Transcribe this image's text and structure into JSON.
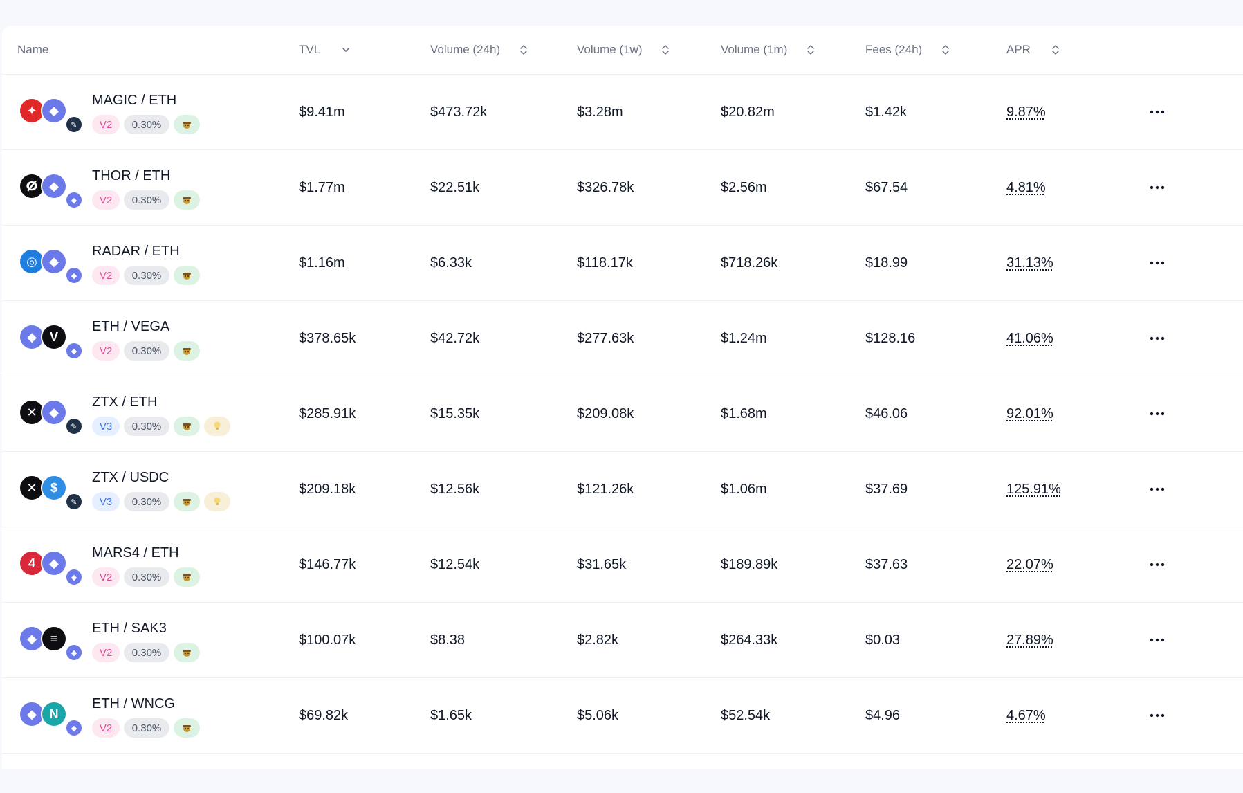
{
  "header": {
    "name": "Name",
    "tvl": "TVL",
    "vol24h": "Volume (24h)",
    "vol1w": "Volume (1w)",
    "vol1m": "Volume (1m)",
    "fees24h": "Fees (24h)",
    "apr": "APR"
  },
  "rows": [
    {
      "pair": "MAGIC / ETH",
      "version": "V2",
      "fee": "0.30%",
      "tvl": "$9.41m",
      "vol24h": "$473.72k",
      "vol1w": "$3.28m",
      "vol1m": "$20.82m",
      "fees24h": "$1.42k",
      "apr": "9.87%",
      "token_a": "magic-token-icon",
      "token_b": "eth-token-icon",
      "chain": "arbitrum-chain-icon",
      "color_a": "#e02828",
      "color_b": "#6b7ae8"
    },
    {
      "pair": "THOR / ETH",
      "version": "V2",
      "fee": "0.30%",
      "tvl": "$1.77m",
      "vol24h": "$22.51k",
      "vol1w": "$326.78k",
      "vol1m": "$2.56m",
      "fees24h": "$67.54",
      "apr": "4.81%",
      "token_a": "thor-token-icon",
      "token_b": "eth-token-icon",
      "chain": "ethereum-chain-icon",
      "color_a": "#0d0d12",
      "color_b": "#6b7ae8"
    },
    {
      "pair": "RADAR / ETH",
      "version": "V2",
      "fee": "0.30%",
      "tvl": "$1.16m",
      "vol24h": "$6.33k",
      "vol1w": "$118.17k",
      "vol1m": "$718.26k",
      "fees24h": "$18.99",
      "apr": "31.13%",
      "token_a": "radar-token-icon",
      "token_b": "eth-token-icon",
      "chain": "ethereum-chain-icon",
      "color_a": "#1f7de0",
      "color_b": "#6b7ae8"
    },
    {
      "pair": "ETH / VEGA",
      "version": "V2",
      "fee": "0.30%",
      "tvl": "$378.65k",
      "vol24h": "$42.72k",
      "vol1w": "$277.63k",
      "vol1m": "$1.24m",
      "fees24h": "$128.16",
      "apr": "41.06%",
      "token_a": "eth-token-icon",
      "token_b": "vega-token-icon",
      "chain": "ethereum-chain-icon",
      "color_a": "#6b7ae8",
      "color_b": "#0d0d12"
    },
    {
      "pair": "ZTX / ETH",
      "version": "V3",
      "fee": "0.30%",
      "tvl": "$285.91k",
      "vol24h": "$15.35k",
      "vol1w": "$209.08k",
      "vol1m": "$1.68m",
      "fees24h": "$46.06",
      "apr": "92.01%",
      "token_a": "ztx-token-icon",
      "token_b": "eth-token-icon",
      "chain": "arbitrum-chain-icon",
      "color_a": "#0d0d12",
      "color_b": "#6b7ae8",
      "tip": true
    },
    {
      "pair": "ZTX / USDC",
      "version": "V3",
      "fee": "0.30%",
      "tvl": "$209.18k",
      "vol24h": "$12.56k",
      "vol1w": "$121.26k",
      "vol1m": "$1.06m",
      "fees24h": "$37.69",
      "apr": "125.91%",
      "token_a": "ztx-token-icon",
      "token_b": "usdc-token-icon",
      "chain": "arbitrum-chain-icon",
      "color_a": "#0d0d12",
      "color_b": "#2f8de4",
      "tip": true
    },
    {
      "pair": "MARS4 / ETH",
      "version": "V2",
      "fee": "0.30%",
      "tvl": "$146.77k",
      "vol24h": "$12.54k",
      "vol1w": "$31.65k",
      "vol1m": "$189.89k",
      "fees24h": "$37.63",
      "apr": "22.07%",
      "token_a": "mars4-token-icon",
      "token_b": "eth-token-icon",
      "chain": "ethereum-chain-icon",
      "color_a": "#d8283a",
      "color_b": "#6b7ae8"
    },
    {
      "pair": "ETH / SAK3",
      "version": "V2",
      "fee": "0.30%",
      "tvl": "$100.07k",
      "vol24h": "$8.38",
      "vol1w": "$2.82k",
      "vol1m": "$264.33k",
      "fees24h": "$0.03",
      "apr": "27.89%",
      "token_a": "eth-token-icon",
      "token_b": "sak3-token-icon",
      "chain": "ethereum-chain-icon",
      "color_a": "#6b7ae8",
      "color_b": "#0d0d12"
    },
    {
      "pair": "ETH / WNCG",
      "version": "V2",
      "fee": "0.30%",
      "tvl": "$69.82k",
      "vol24h": "$1.65k",
      "vol1w": "$5.06k",
      "vol1m": "$52.54k",
      "fees24h": "$4.96",
      "apr": "4.67%",
      "token_a": "eth-token-icon",
      "token_b": "wncg-token-icon",
      "chain": "ethereum-chain-icon",
      "color_a": "#6b7ae8",
      "color_b": "#1aa6a6"
    }
  ]
}
